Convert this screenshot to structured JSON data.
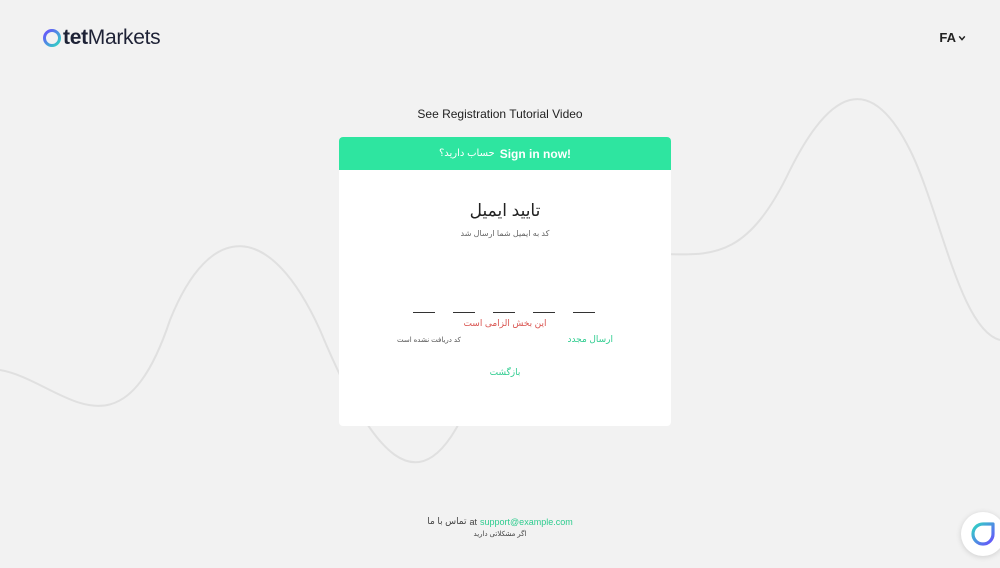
{
  "header": {
    "logo": {
      "brand": "tet",
      "suffix": "Markets"
    },
    "language": {
      "label": "FA",
      "icon": "chevron-down-icon"
    }
  },
  "tutorial_link": "See Registration Tutorial Video",
  "card": {
    "banner": {
      "question": "حساب دارید؟",
      "link": "Sign in now!"
    },
    "title": "تایید ایمیل",
    "subtitle": "کد به ایمیل شما ارسال شد",
    "otp_fields": [
      "",
      "",
      "",
      "",
      ""
    ],
    "error": "این بخش الزامی است",
    "resend": "ارسال مجدد",
    "not_received": "کد دریافت نشده است",
    "back": "بازگشت"
  },
  "footer": {
    "contact_label": "تماس با ما",
    "at": "at",
    "email": "support@example.com",
    "help_text": "اگر مشکلاتی دارید"
  },
  "colors": {
    "accent": "#2ee5a0",
    "link": "#2ecc8f",
    "error": "#d9534f",
    "background": "#f2f2f2"
  },
  "icons": {
    "chat": "chat-widget-icon",
    "logo": "logo-mark-icon"
  }
}
